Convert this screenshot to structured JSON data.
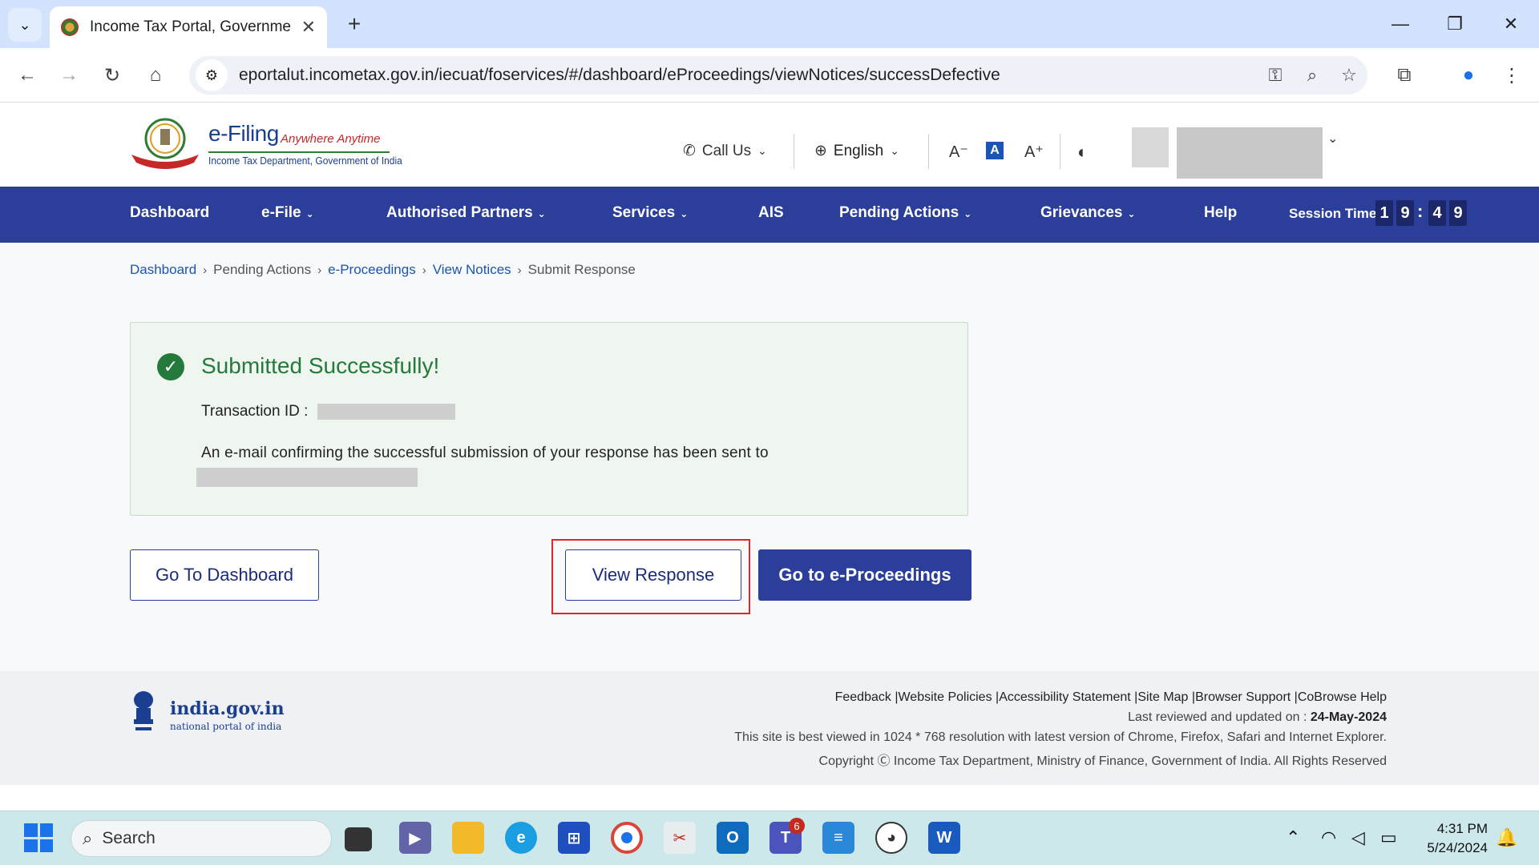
{
  "browser": {
    "tab_title": "Income Tax Portal, Government",
    "url": "eportalut.incometax.gov.in/iecuat/foservices/#/dashboard/eProceedings/viewNotices/successDefective"
  },
  "header": {
    "logo_title": "e-Filing",
    "logo_tagline": "Anywhere Anytime",
    "logo_subtitle": "Income Tax Department, Government of India",
    "call_us": "Call Us",
    "language": "English",
    "font_decrease": "A⁻",
    "font_default": "A",
    "font_increase": "A⁺"
  },
  "nav": {
    "items": [
      "Dashboard",
      "e-File",
      "Authorised Partners",
      "Services",
      "AIS",
      "Pending Actions",
      "Grievances",
      "Help"
    ],
    "session_label": "Session Time",
    "session_digits": [
      "1",
      "9",
      "4",
      "9"
    ],
    "session_colon": ":"
  },
  "breadcrumb": {
    "items": [
      "Dashboard",
      "Pending Actions",
      "e-Proceedings",
      "View Notices",
      "Submit Response"
    ]
  },
  "success": {
    "title": "Submitted Successfully!",
    "transaction_label": "Transaction ID :",
    "email_message": "An e-mail confirming the successful submission of your response has been sent to"
  },
  "buttons": {
    "go_dashboard": "Go To Dashboard",
    "view_response": "View Response",
    "go_eproceedings": "Go to e-Proceedings"
  },
  "footer": {
    "portal_title": "india.gov.in",
    "portal_subtitle": "national portal of india",
    "links": [
      "Feedback",
      "Website Policies",
      "Accessibility Statement",
      "Site Map",
      "Browser Support",
      "CoBrowse Help"
    ],
    "last_reviewed_label": "Last reviewed and updated on : ",
    "last_reviewed_date": "24-May-2024",
    "best_viewed": "This site is best viewed in 1024 * 768 resolution with latest version of Chrome, Firefox, Safari and Internet Explorer.",
    "copyright": "Copyright Ⓒ Income Tax Department, Ministry of Finance, Government of India. All Rights Reserved"
  },
  "taskbar": {
    "search_label": "Search",
    "teams_badge": "6",
    "time": "4:31 PM",
    "date": "5/24/2024"
  },
  "colors": {
    "nav_blue": "#2a3e9a",
    "success_green": "#237a3b",
    "highlight_red": "#e3242b"
  }
}
